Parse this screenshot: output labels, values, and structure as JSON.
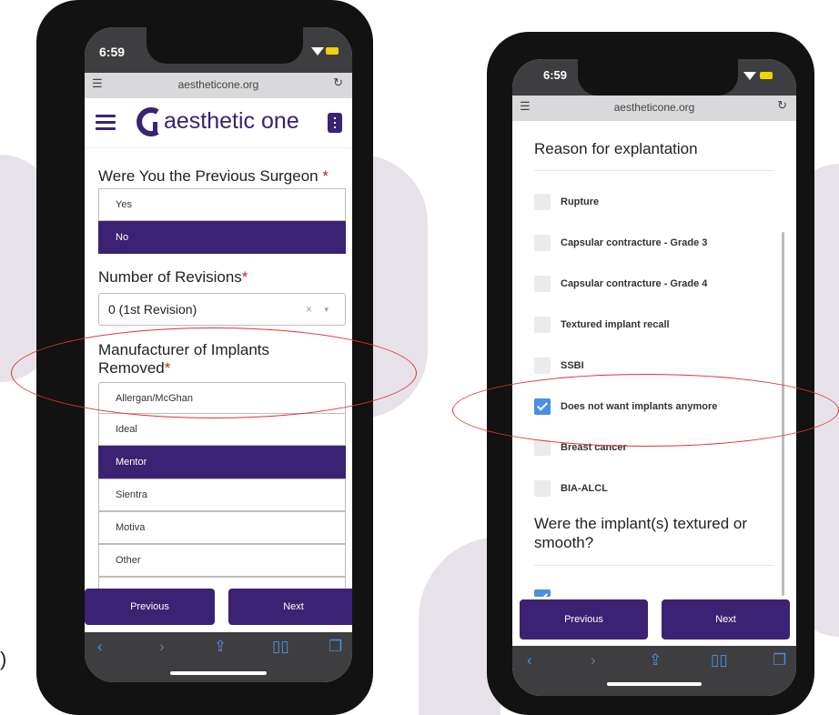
{
  "left_phone": {
    "status_time": "6:59",
    "url": "aestheticone.org",
    "brand": "aesthetic one",
    "q1": {
      "label": "Were You the Previous Surgeon ",
      "required_mark": "*",
      "options": [
        "Yes",
        "No"
      ],
      "selected": "No"
    },
    "q2": {
      "label": "Number of Revisions",
      "required_mark": "*",
      "value": "0 (1st Revision)",
      "clear_glyph": "×",
      "caret_glyph": "▾"
    },
    "q3": {
      "label": "Manufacturer of Implants Removed",
      "required_mark": "*",
      "options": [
        "Allergan/McGhan",
        "Ideal",
        "Mentor",
        "Sientra",
        "Motiva",
        "Other"
      ],
      "selected": "Mentor"
    },
    "prev_label": "Previous",
    "next_label": "Next"
  },
  "right_phone": {
    "status_time": "6:59",
    "url": "aestheticone.org",
    "section_title": "Reason for explantation",
    "reasons": [
      {
        "label": "Rupture",
        "checked": false
      },
      {
        "label": "Capsular contracture - Grade 3",
        "checked": false
      },
      {
        "label": "Capsular contracture - Grade 4",
        "checked": false
      },
      {
        "label": "Textured implant recall",
        "checked": false
      },
      {
        "label": "SSBI",
        "checked": false
      },
      {
        "label": "Does not want implants anymore",
        "checked": true
      },
      {
        "label": "Breast cancer",
        "checked": false
      },
      {
        "label": "BIA-ALCL",
        "checked": false
      }
    ],
    "next_question": "Were the implant(s) textured or smooth?",
    "prev_label": "Previous",
    "next_label": "Next"
  },
  "stray_glyph": ")",
  "colors": {
    "brand_purple": "#3b2272",
    "highlight_red": "#e0342b",
    "checkbox_blue": "#4a8fe0"
  },
  "icons": {
    "back": "chevron-left-icon",
    "forward": "chevron-right-icon",
    "share": "share-icon",
    "bookmarks": "book-icon",
    "tabs": "tabs-icon"
  }
}
